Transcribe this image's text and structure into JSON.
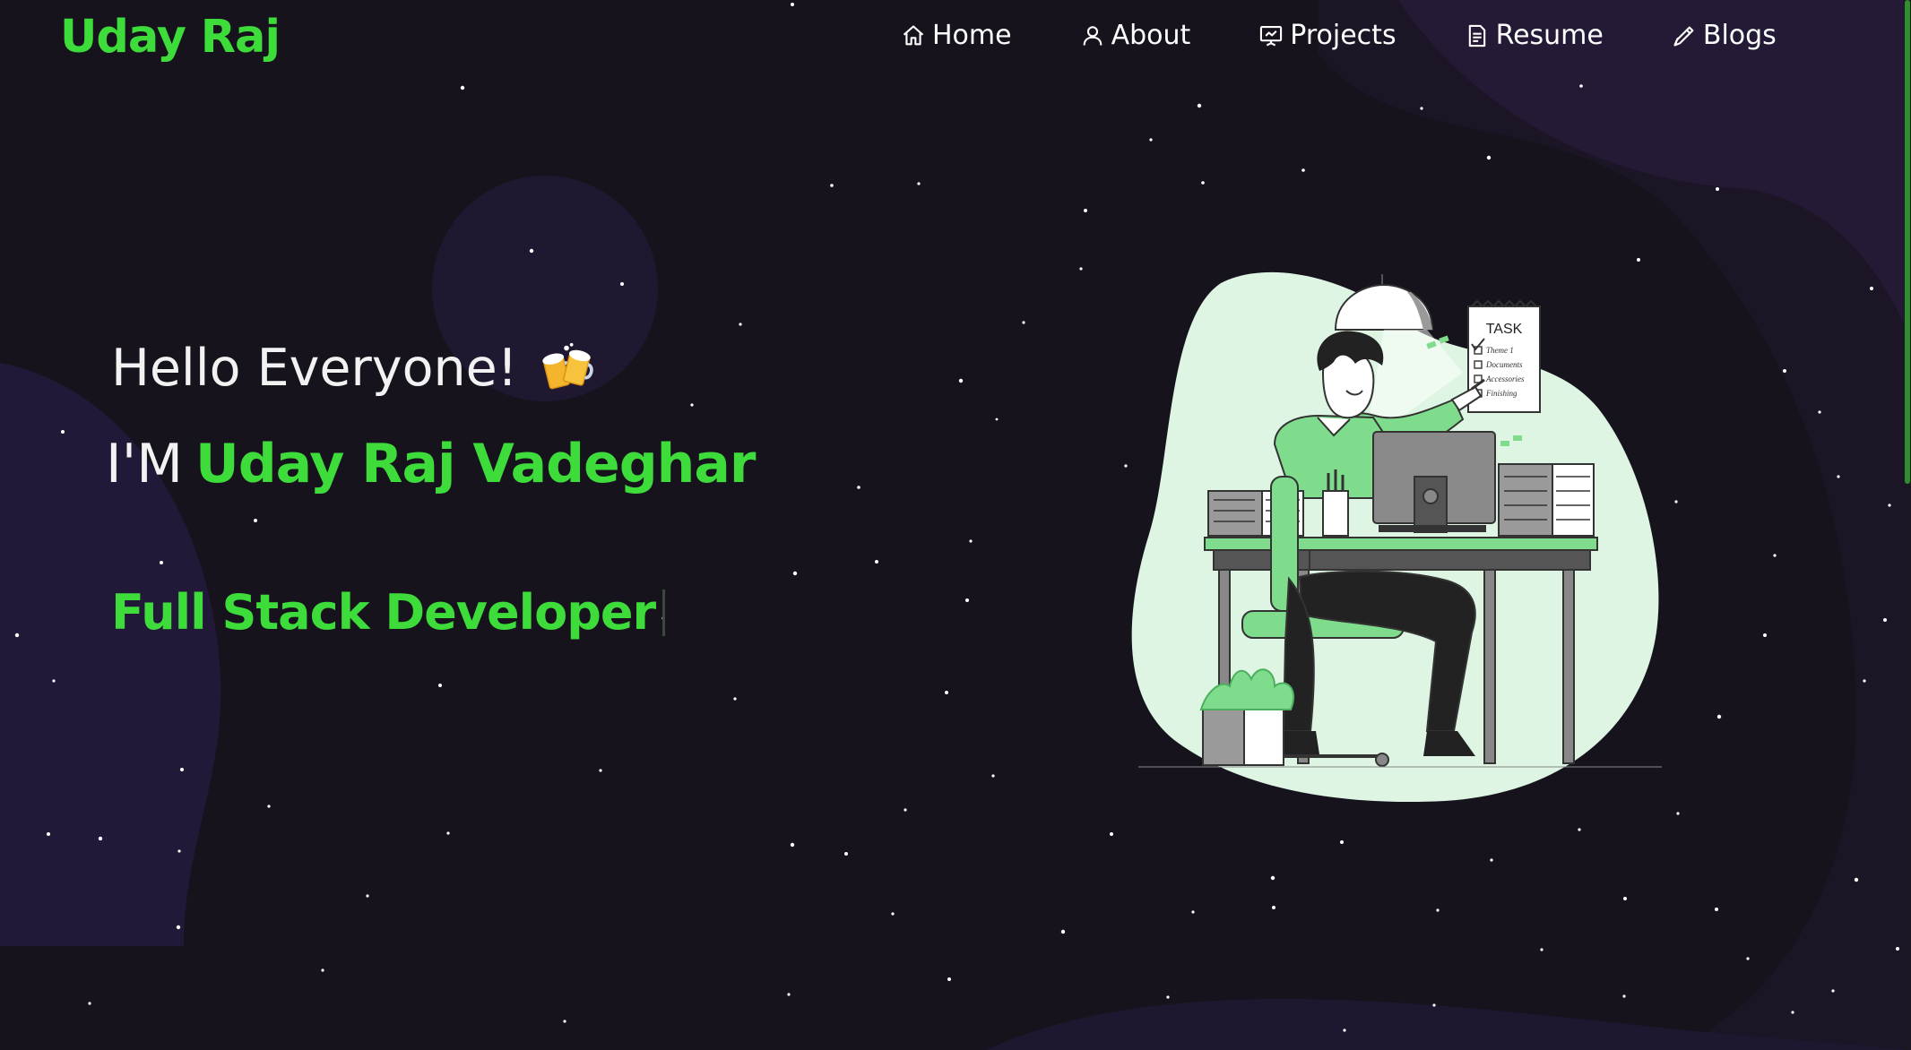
{
  "brand": "Uday Raj",
  "nav": [
    {
      "label": "Home",
      "icon": "home-icon"
    },
    {
      "label": "About",
      "icon": "user-icon"
    },
    {
      "label": "Projects",
      "icon": "presentation-icon"
    },
    {
      "label": "Resume",
      "icon": "document-icon"
    },
    {
      "label": "Blogs",
      "icon": "pen-icon"
    }
  ],
  "hero": {
    "greeting": "Hello Everyone!",
    "greeting_icon": "beer-mugs-icon",
    "intro_prefix": "I'M",
    "name": "Uday Raj Vadeghar",
    "role": "Full Stack Developer"
  },
  "illustration": {
    "task_card": {
      "title": "TASK",
      "items": [
        "Theme 1",
        "Documents",
        "Accessories",
        "Finishing"
      ]
    }
  },
  "colors": {
    "accent": "#3ddc3a",
    "background": "#15121c",
    "blob": "#261a3c",
    "illustration_bg": "#def5e3",
    "illustration_green": "#7fdc8d"
  }
}
